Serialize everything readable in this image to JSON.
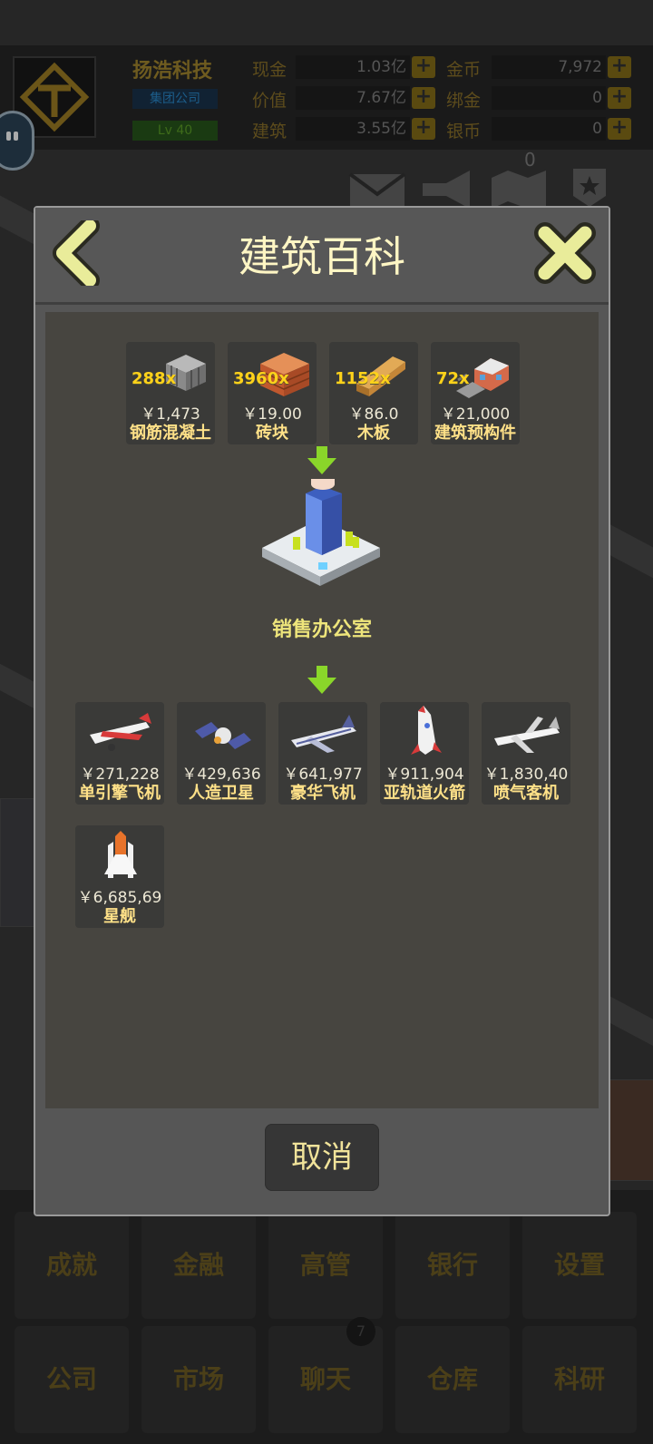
{
  "hud": {
    "company_name": "扬浩科技",
    "company_type": "集团公司",
    "level": "Lv 40",
    "stats_left": [
      {
        "label": "现金",
        "value": "1.03亿"
      },
      {
        "label": "价值",
        "value": "7.67亿"
      },
      {
        "label": "建筑",
        "value": "3.55亿"
      }
    ],
    "stats_right": [
      {
        "label": "金币",
        "value": "7,972"
      },
      {
        "label": "绑金",
        "value": "0"
      },
      {
        "label": "银币",
        "value": "0"
      }
    ],
    "map_badge": "0",
    "icons": [
      "mail-icon",
      "megaphone-icon",
      "map-icon",
      "badge-icon"
    ]
  },
  "bottom_nav": {
    "row1": [
      "成就",
      "金融",
      "高管",
      "银行",
      "设置"
    ],
    "row2": [
      "公司",
      "市场",
      "聊天",
      "仓库",
      "科研"
    ],
    "chat_badge": "7"
  },
  "modal": {
    "title": "建筑百科",
    "cancel_label": "取消",
    "inputs": [
      {
        "qty": "288x",
        "price": "￥1,473",
        "name": "钢筋混凝土",
        "icon": "steel-concrete-icon"
      },
      {
        "qty": "3960x",
        "price": "￥19.00",
        "name": "砖块",
        "icon": "brick-icon"
      },
      {
        "qty": "1152x",
        "price": "￥86.0",
        "name": "木板",
        "icon": "plank-icon"
      },
      {
        "qty": "72x",
        "price": "￥21,000",
        "name": "建筑预构件",
        "icon": "prefab-icon"
      }
    ],
    "building": {
      "name": "销售办公室",
      "icon": "office-building-icon"
    },
    "outputs": [
      {
        "price": "￥271,228",
        "name": "单引擎飞机",
        "icon": "single-engine-plane-icon"
      },
      {
        "price": "￥429,636",
        "name": "人造卫星",
        "icon": "satellite-icon"
      },
      {
        "price": "￥641,977",
        "name": "豪华飞机",
        "icon": "luxury-jet-icon"
      },
      {
        "price": "￥911,904",
        "name": "亚轨道火箭",
        "icon": "rocket-icon"
      },
      {
        "price": "￥1,830,40",
        "name": "喷气客机",
        "icon": "airliner-icon"
      },
      {
        "price": "￥6,685,69",
        "name": "星舰",
        "icon": "space-shuttle-icon"
      }
    ]
  }
}
